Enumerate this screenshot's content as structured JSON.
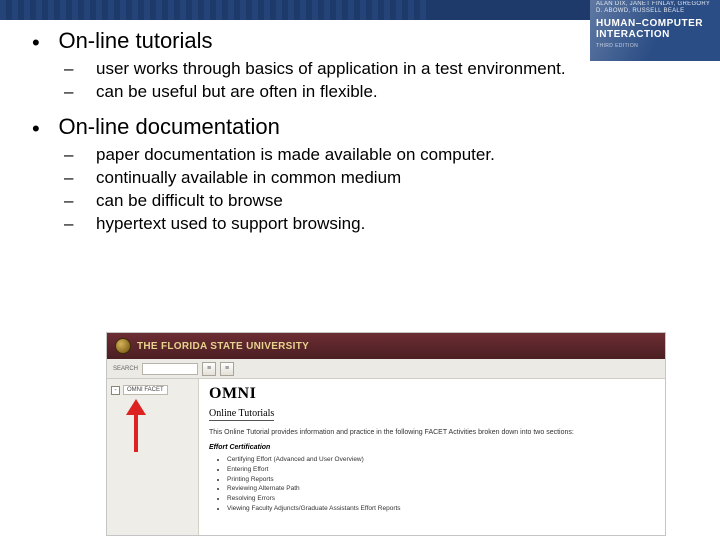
{
  "badge": {
    "authors": "ALAN DIX, JANET FINLAY,\nGREGORY D. ABOWD, RUSSELL BEALE",
    "title1": "HUMAN–COMPUTER",
    "title2": "INTERACTION",
    "edition": "THIRD EDITION"
  },
  "bullets": [
    {
      "label": "On-line tutorials",
      "subs": [
        "user works through basics of application in a test environment.",
        "can be useful but are often in flexible."
      ]
    },
    {
      "label": "On-line documentation",
      "subs": [
        "paper documentation is made available on computer.",
        "continually available in common medium",
        "can be difficult to browse",
        "hypertext used to support browsing."
      ]
    }
  ],
  "screenshot": {
    "university": "THE FLORIDA STATE UNIVERSITY",
    "search_label": "SEARCH",
    "toolbar_btn1": "≡",
    "toolbar_btn2": "≡",
    "tree_toggle": "-",
    "side_node": "OMNI FACET",
    "omni_title": "OMNI",
    "omni_subtitle": "Online Tutorials",
    "intro": "This Online Tutorial provides information and practice in the following FACET Activities broken down into two sections:",
    "effort_heading": "Effort Certification",
    "effort_items": [
      "Certifying Effort (Advanced and User Overview)",
      "Entering Effort",
      "Printing Reports",
      "Reviewing Alternate Path",
      "Resolving Errors",
      "Viewing Faculty Adjuncts/Graduate Assistants Effort Reports"
    ]
  }
}
